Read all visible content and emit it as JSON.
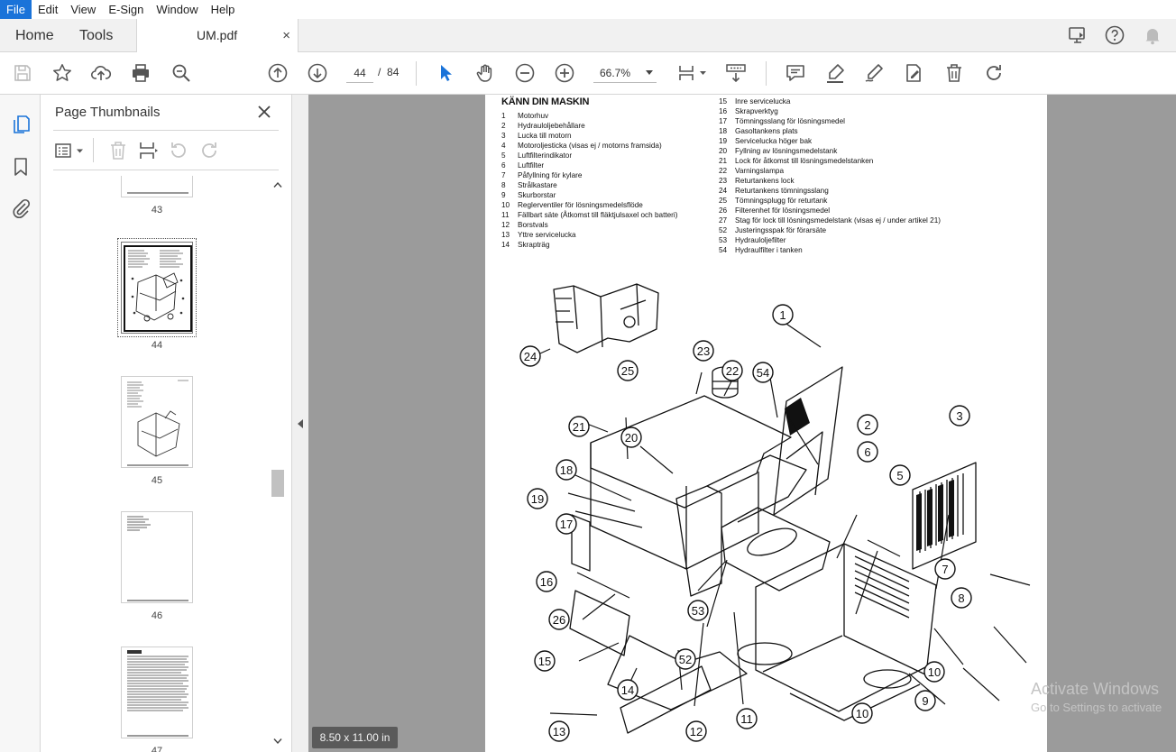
{
  "menu": [
    "File",
    "Edit",
    "View",
    "E-Sign",
    "Window",
    "Help"
  ],
  "tabs": {
    "home": "Home",
    "tools": "Tools",
    "document": "UM.pdf",
    "close": "×"
  },
  "toolbar": {
    "current_page": "44",
    "page_separator": "/",
    "total_pages": "84",
    "zoom": "66.7%"
  },
  "thumbnails": {
    "title": "Page Thumbnails",
    "pages": [
      {
        "label": "43"
      },
      {
        "label": "44",
        "selected": true
      },
      {
        "label": "45"
      },
      {
        "label": "46"
      },
      {
        "label": "47"
      }
    ]
  },
  "document": {
    "heading": "KÄNN DIN MASKIN",
    "legend_left": [
      {
        "num": "1",
        "text": "Motorhuv"
      },
      {
        "num": "2",
        "text": "Hydrauloljebehållare"
      },
      {
        "num": "3",
        "text": "Lucka till motorn"
      },
      {
        "num": "4",
        "text": "Motoroljesticka (visas ej / motorns framsida)"
      },
      {
        "num": "5",
        "text": "Luftfilterindikator"
      },
      {
        "num": "6",
        "text": "Luftfilter"
      },
      {
        "num": "7",
        "text": "Påfyllning för kylare"
      },
      {
        "num": "8",
        "text": "Strålkastare"
      },
      {
        "num": "9",
        "text": "Skurborstar"
      },
      {
        "num": "10",
        "text": "Reglerventiler för lösningsmedelsflöde"
      },
      {
        "num": "11",
        "text": "Fällbart säte (Åtkomst till fläktjulsaxel och batteri)"
      },
      {
        "num": "12",
        "text": "Borstvals"
      },
      {
        "num": "13",
        "text": "Yttre servicelucka"
      },
      {
        "num": "14",
        "text": "Skrapträg"
      }
    ],
    "legend_right": [
      {
        "num": "15",
        "text": "Inre servicelucka"
      },
      {
        "num": "16",
        "text": "Skrapverktyg"
      },
      {
        "num": "17",
        "text": "Tömningsslang för lösningsmedel"
      },
      {
        "num": "18",
        "text": "Gasoltankens plats"
      },
      {
        "num": "19",
        "text": "Servicelucka höger bak"
      },
      {
        "num": "20",
        "text": "Fyllning av lösningsmedelstank"
      },
      {
        "num": "21",
        "text": "Lock för åtkomst till lösningsmedelstanken"
      },
      {
        "num": "22",
        "text": "Varningslampa"
      },
      {
        "num": "23",
        "text": "Returtankens lock"
      },
      {
        "num": "24",
        "text": "Returtankens tömningsslang"
      },
      {
        "num": "25",
        "text": "Tömningsplugg för returtank"
      },
      {
        "num": "26",
        "text": "Filterenhet för lösningsmedel"
      },
      {
        "num": "27",
        "text": "Stag för lock till lösningsmedelstank (visas ej / under artikel 21)"
      },
      {
        "num": "52",
        "text": "Justeringsspak för förarsäte"
      },
      {
        "num": "53",
        "text": "Hydrauloljefilter"
      },
      {
        "num": "54",
        "text": "Hydraulfilter i tanken"
      }
    ],
    "callouts": [
      "1",
      "2",
      "3",
      "5",
      "6",
      "7",
      "8",
      "9",
      "10",
      "10",
      "11",
      "12",
      "13",
      "14",
      "15",
      "16",
      "17",
      "18",
      "19",
      "20",
      "21",
      "22",
      "23",
      "24",
      "25",
      "26",
      "52",
      "53",
      "54"
    ]
  },
  "page_size": "8.50 x 11.00 in",
  "watermark": {
    "line1": "Activate Windows",
    "line2": "Go to Settings to activate"
  }
}
